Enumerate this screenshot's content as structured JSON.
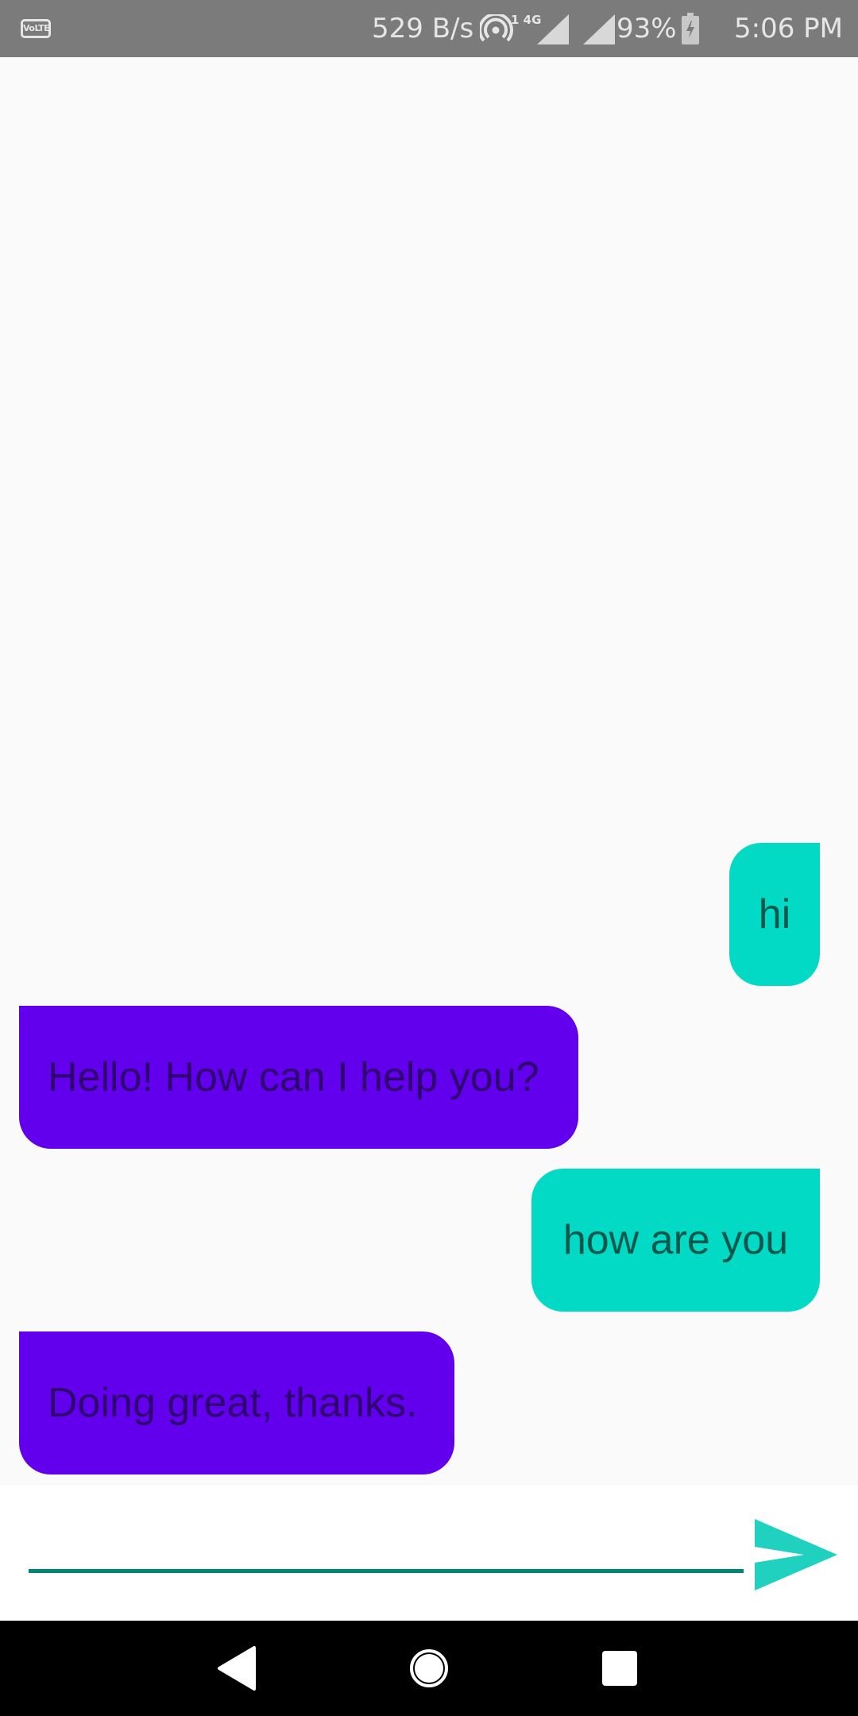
{
  "status_bar": {
    "volte_label": "VoLTE",
    "net_speed": "529 B/s",
    "lte_label": "1 4G",
    "battery_percent": "93%",
    "time": "5:06 PM",
    "icons": [
      "volte-icon",
      "hotspot-icon",
      "signal-icon",
      "signal-icon",
      "battery-charging-icon"
    ]
  },
  "chat": {
    "messages": [
      {
        "sender": "user",
        "text": "hi"
      },
      {
        "sender": "bot",
        "text": "Hello! How can I help you?"
      },
      {
        "sender": "user",
        "text": "how are you"
      },
      {
        "sender": "bot",
        "text": "Doing great, thanks."
      }
    ]
  },
  "input": {
    "value": "",
    "placeholder": ""
  },
  "colors": {
    "user_bubble": "#03dac5",
    "user_text": "#00574b",
    "bot_bubble": "#6200ee",
    "bot_text": "#2e0070",
    "accent": "#008577",
    "send_icon": "#1fd1be"
  },
  "nav_bar": {
    "icons": [
      "back-icon",
      "home-icon",
      "recents-icon"
    ]
  }
}
